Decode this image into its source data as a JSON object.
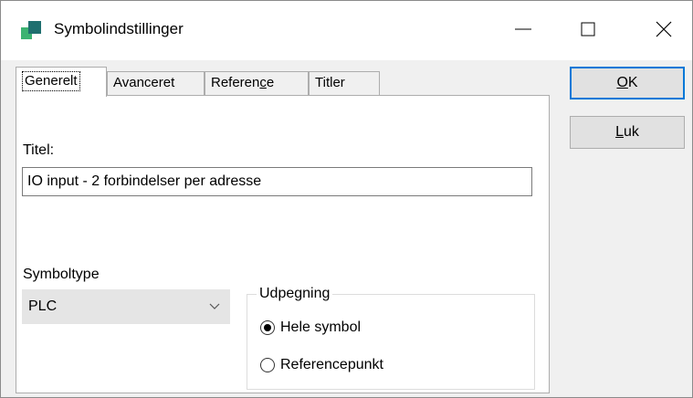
{
  "window": {
    "title": "Symbolindstillinger",
    "controls": {
      "minimize": "minimize-icon",
      "maximize": "maximize-icon",
      "close": "close-icon"
    }
  },
  "tabs": [
    {
      "label": "Generelt",
      "active": true
    },
    {
      "label": "Avanceret",
      "active": false
    },
    {
      "pre": "Referen",
      "mnemonic": "c",
      "post": "e",
      "active": false
    },
    {
      "label": "Titler",
      "active": false
    }
  ],
  "general": {
    "title_label": "Titel:",
    "title_value": "IO input - 2 forbindelser per adresse",
    "symboltype_label": "Symboltype",
    "symboltype_value": "PLC",
    "designation": {
      "legend": "Udpegning",
      "options": [
        {
          "label": "Hele symbol",
          "checked": true
        },
        {
          "label": "Referencepunkt",
          "checked": false
        }
      ]
    }
  },
  "buttons": {
    "ok": {
      "mnemonic": "O",
      "rest": "K"
    },
    "close": {
      "mnemonic": "L",
      "rest": "uk"
    }
  },
  "colors": {
    "focus_border": "#0078d7",
    "app_icon_light": "#3cb371",
    "app_icon_dark": "#1f6f6f"
  }
}
